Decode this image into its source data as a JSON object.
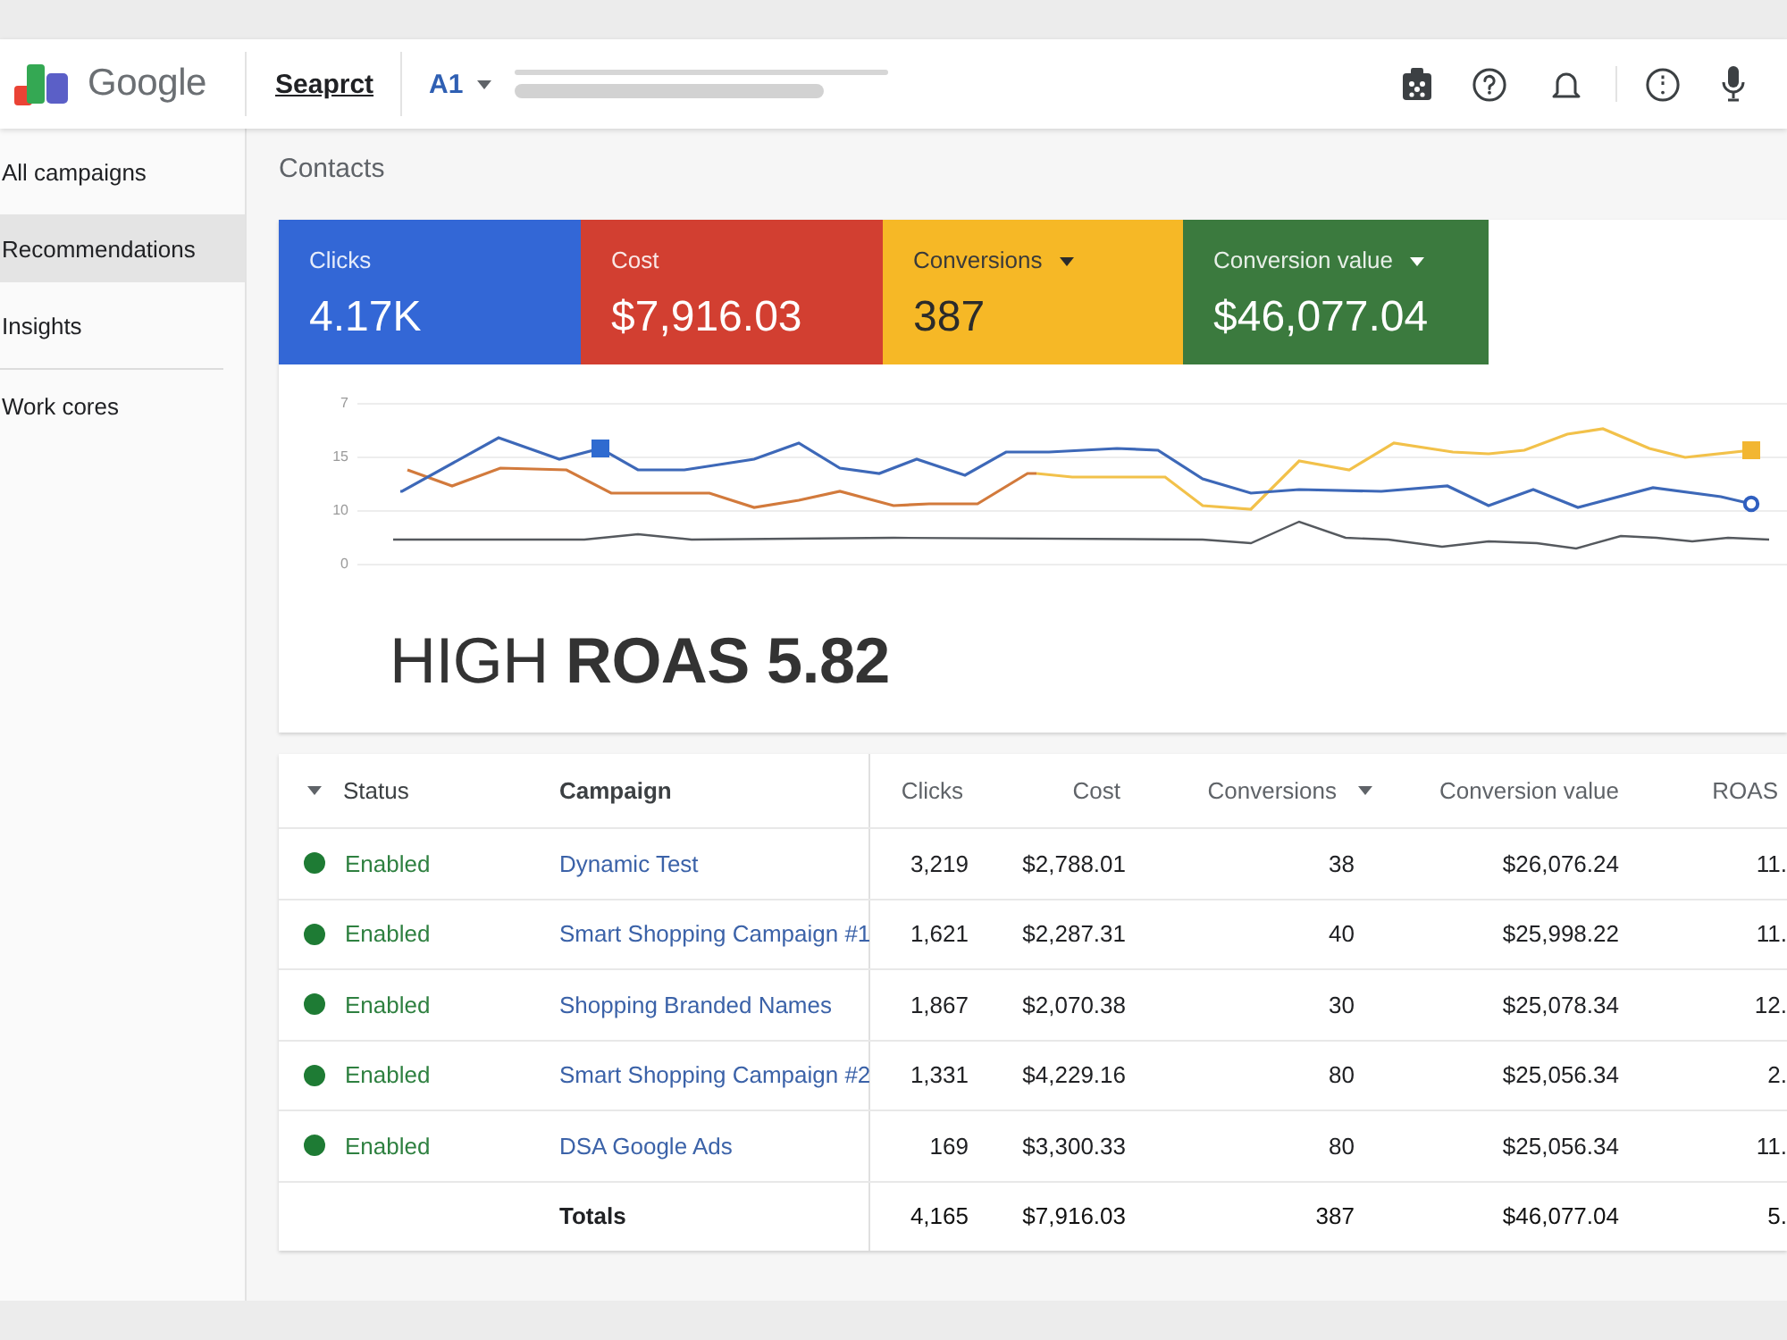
{
  "top_bar": {
    "logo_text": "Google",
    "property": "Seaprct",
    "account": "A1"
  },
  "sidebar": {
    "groups": [
      {
        "items": [
          {
            "label": "All campaigns",
            "selected": false
          },
          {
            "label": "Recommendations",
            "selected": true
          },
          {
            "label": "Insights",
            "selected": false
          }
        ]
      },
      {
        "items": [
          {
            "label": "Work cores",
            "selected": false
          }
        ]
      }
    ]
  },
  "page_title": "Contacts",
  "metrics": [
    {
      "label": "Clicks",
      "value": "4.17K",
      "color": "#3367d6",
      "dropdown": false
    },
    {
      "label": "Cost",
      "value": "$7,916.03",
      "color": "#d23f31",
      "dropdown": false
    },
    {
      "label": "Conversions",
      "value": "387",
      "color": "#f6b826",
      "dropdown": true
    },
    {
      "label": "Conversion value",
      "value": "$46,077.04",
      "color": "#3b7a3e",
      "dropdown": true
    }
  ],
  "chart": {
    "y_tick_labels": [
      "7",
      "15",
      "10",
      "0"
    ]
  },
  "headline": "HIGH **ROAS 5.82**",
  "table": {
    "columns": [
      {
        "label": "Status",
        "leading_caret": true,
        "trailing_caret": false
      },
      {
        "label": "Campaign",
        "leading_caret": false,
        "trailing_caret": false
      },
      {
        "label": "Clicks",
        "leading_caret": false,
        "trailing_caret": false
      },
      {
        "label": "Cost",
        "leading_caret": false,
        "trailing_caret": false
      },
      {
        "label": "Conversions",
        "leading_caret": false,
        "trailing_caret": true
      },
      {
        "label": "Conversion value",
        "leading_caret": false,
        "trailing_caret": false
      },
      {
        "label": "ROAS",
        "leading_caret": false,
        "trailing_caret": false
      }
    ],
    "rows": [
      {
        "status": "Enabled",
        "enabled": true,
        "campaign": "Dynamic Test",
        "clicks": "3,219",
        "cost": "$2,788.01",
        "conversions": "38",
        "conversion_value": "$26,076.24",
        "roas": "11."
      },
      {
        "status": "Enabled",
        "enabled": true,
        "campaign": "Smart Shopping Campaign #1",
        "clicks": "1,621",
        "cost": "$2,287.31",
        "conversions": "40",
        "conversion_value": "$25,998.22",
        "roas": "11."
      },
      {
        "status": "Enabled",
        "enabled": true,
        "campaign": "Shopping Branded Names",
        "clicks": "1,867",
        "cost": "$2,070.38",
        "conversions": "30",
        "conversion_value": "$25,078.34",
        "roas": "12."
      },
      {
        "status": "Enabled",
        "enabled": true,
        "campaign": "Smart Shopping Campaign #2",
        "clicks": "1,331",
        "cost": "$4,229.16",
        "conversions": "80",
        "conversion_value": "$25,056.34",
        "roas": "2."
      },
      {
        "status": "Enabled",
        "enabled": true,
        "campaign": "DSA Google Ads",
        "clicks": "169",
        "cost": "$3,300.33",
        "conversions": "80",
        "conversion_value": "$25,056.34",
        "roas": "11."
      }
    ],
    "totals": {
      "label": "Totals",
      "clicks": "4,165",
      "cost": "$7,916.03",
      "conversions": "387",
      "conversion_value": "$46,077.04",
      "roas": "5."
    }
  }
}
